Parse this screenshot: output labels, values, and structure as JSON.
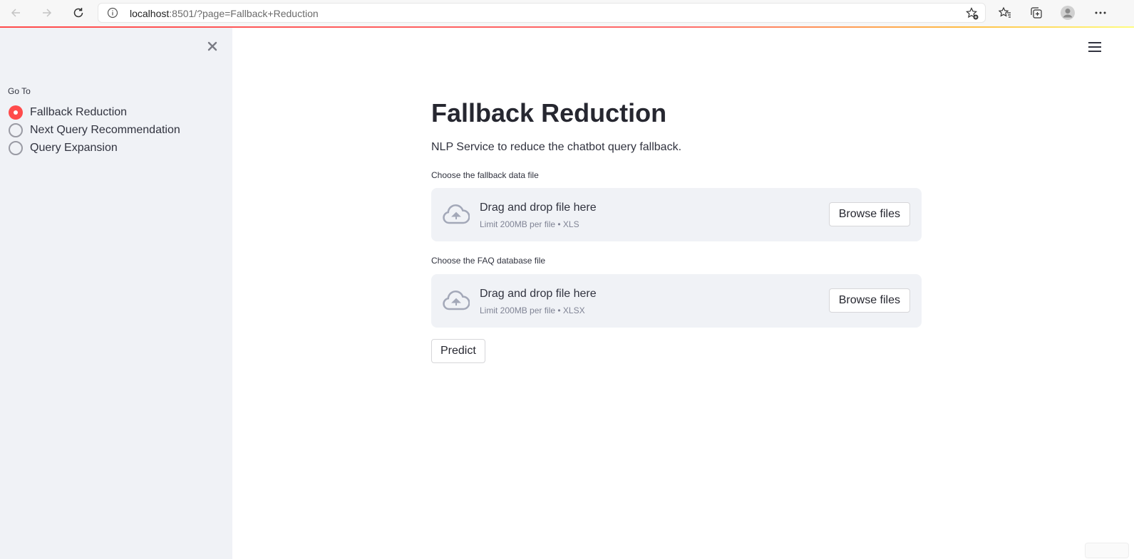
{
  "browser": {
    "url_host": "localhost",
    "url_rest": ":8501/?page=Fallback+Reduction"
  },
  "sidebar": {
    "label": "Go To",
    "options": [
      {
        "label": "Fallback Reduction",
        "selected": true
      },
      {
        "label": "Next Query Recommendation",
        "selected": false
      },
      {
        "label": "Query Expansion",
        "selected": false
      }
    ]
  },
  "main": {
    "title": "Fallback Reduction",
    "subtitle": "NLP Service to reduce the chatbot query fallback.",
    "uploaders": [
      {
        "label": "Choose the fallback data file",
        "drop_text": "Drag and drop file here",
        "limit_text": "Limit 200MB per file • XLS",
        "button": "Browse files"
      },
      {
        "label": "Choose the FAQ database file",
        "drop_text": "Drag and drop file here",
        "limit_text": "Limit 200MB per file • XLSX",
        "button": "Browse files"
      }
    ],
    "predict_button": "Predict"
  },
  "colors": {
    "accent": "#ff4b4b",
    "sidebar_bg": "#f0f2f6",
    "text": "#262730"
  },
  "icons": [
    "back-icon",
    "forward-icon",
    "refresh-icon",
    "info-icon",
    "favorite-add-icon",
    "favorites-icon",
    "collections-icon",
    "profile-icon",
    "more-icon",
    "close-icon",
    "hamburger-menu-icon",
    "cloud-upload-icon"
  ]
}
